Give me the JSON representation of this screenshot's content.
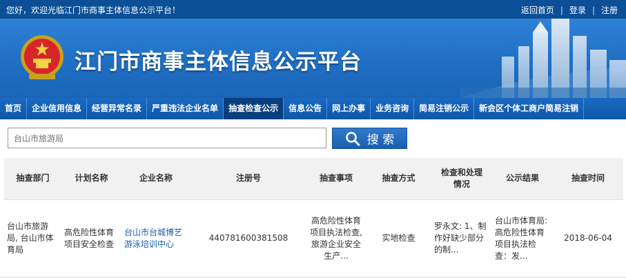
{
  "topbar": {
    "welcome": "您好，欢迎光临江门市商事主体信息公示平台！",
    "links": [
      "返回首页",
      "登录",
      "注册"
    ],
    "separator": "|"
  },
  "banner": {
    "title": "江门市商事主体信息公示平台"
  },
  "nav": {
    "items": [
      "首页",
      "企业信用信息",
      "经营异常名录",
      "严重违法企业名单",
      "抽查检查公示",
      "信息公告",
      "网上办事",
      "业务咨询",
      "简易注销公示",
      "新会区个体工商户简易注销"
    ],
    "active_index": 4
  },
  "search": {
    "value": "台山市旅游局",
    "button_label": "搜 索"
  },
  "table": {
    "headers": [
      "抽查部门",
      "计划名称",
      "企业名称",
      "注册号",
      "抽查事项",
      "抽查方式",
      "检查和处理\n情况",
      "公示结果",
      "抽查时间"
    ],
    "rows": [
      {
        "department": "台山市旅游局, 台山市体育局",
        "plan": "高危险性体育项目安全检查",
        "company": "台山市台城博艺游泳培训中心",
        "reg_no": "440781600381508",
        "items": "高危险性体育项目执法检查, 旅游企业安全生产...",
        "method": "实地检查",
        "handling": "罗永文: 1、制作好缺少部分的制...",
        "result": "台山市体育局: 高危险性体育项目执法检查：发...",
        "date": "2018-06-04"
      }
    ]
  },
  "colors": {
    "topbar": "#0b4f96",
    "banner": "#2f82d6",
    "nav": "#1a6bc2",
    "nav_active": "#0a3f7e",
    "link": "#1b5cae"
  }
}
